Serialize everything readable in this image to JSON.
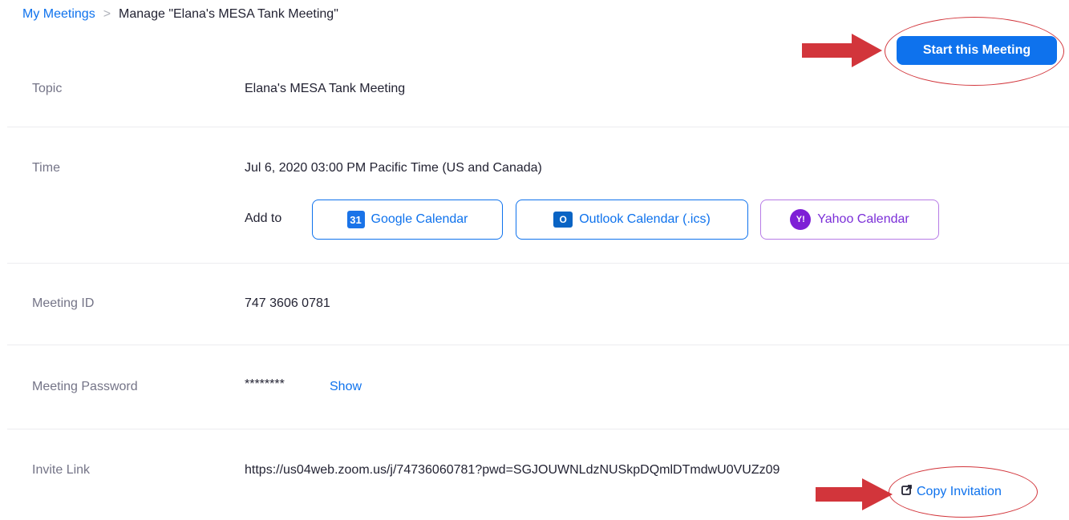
{
  "breadcrumb": {
    "parent": "My Meetings",
    "separator": ">",
    "current": "Manage \"Elana's MESA Tank Meeting\""
  },
  "actions": {
    "start_label": "Start this Meeting"
  },
  "fields": {
    "topic": {
      "label": "Topic",
      "value": "Elana's MESA Tank Meeting"
    },
    "time": {
      "label": "Time",
      "value": "Jul 6, 2020 03:00 PM Pacific Time (US and Canada)",
      "add_to_label": "Add to",
      "calendars": [
        {
          "label": "Google Calendar",
          "icon": "google-calendar-icon",
          "icon_text": "31"
        },
        {
          "label": "Outlook Calendar (.ics)",
          "icon": "outlook-calendar-icon",
          "icon_text": "O"
        },
        {
          "label": "Yahoo Calendar",
          "icon": "yahoo-calendar-icon",
          "icon_text": "Y!"
        }
      ]
    },
    "meeting_id": {
      "label": "Meeting ID",
      "value": "747 3606 0781"
    },
    "password": {
      "label": "Meeting Password",
      "value": "********",
      "show_label": "Show"
    },
    "invite": {
      "label": "Invite Link",
      "value": "https://us04web.zoom.us/j/74736060781?pwd=SGJOUWNLdzNUSkpDQmlDTmdwU0VUZz09",
      "copy_label": "Copy Invitation"
    }
  },
  "colors": {
    "accent": "#0e72ed",
    "annotation": "#d2353b",
    "yahoo": "#7e1fd6"
  }
}
